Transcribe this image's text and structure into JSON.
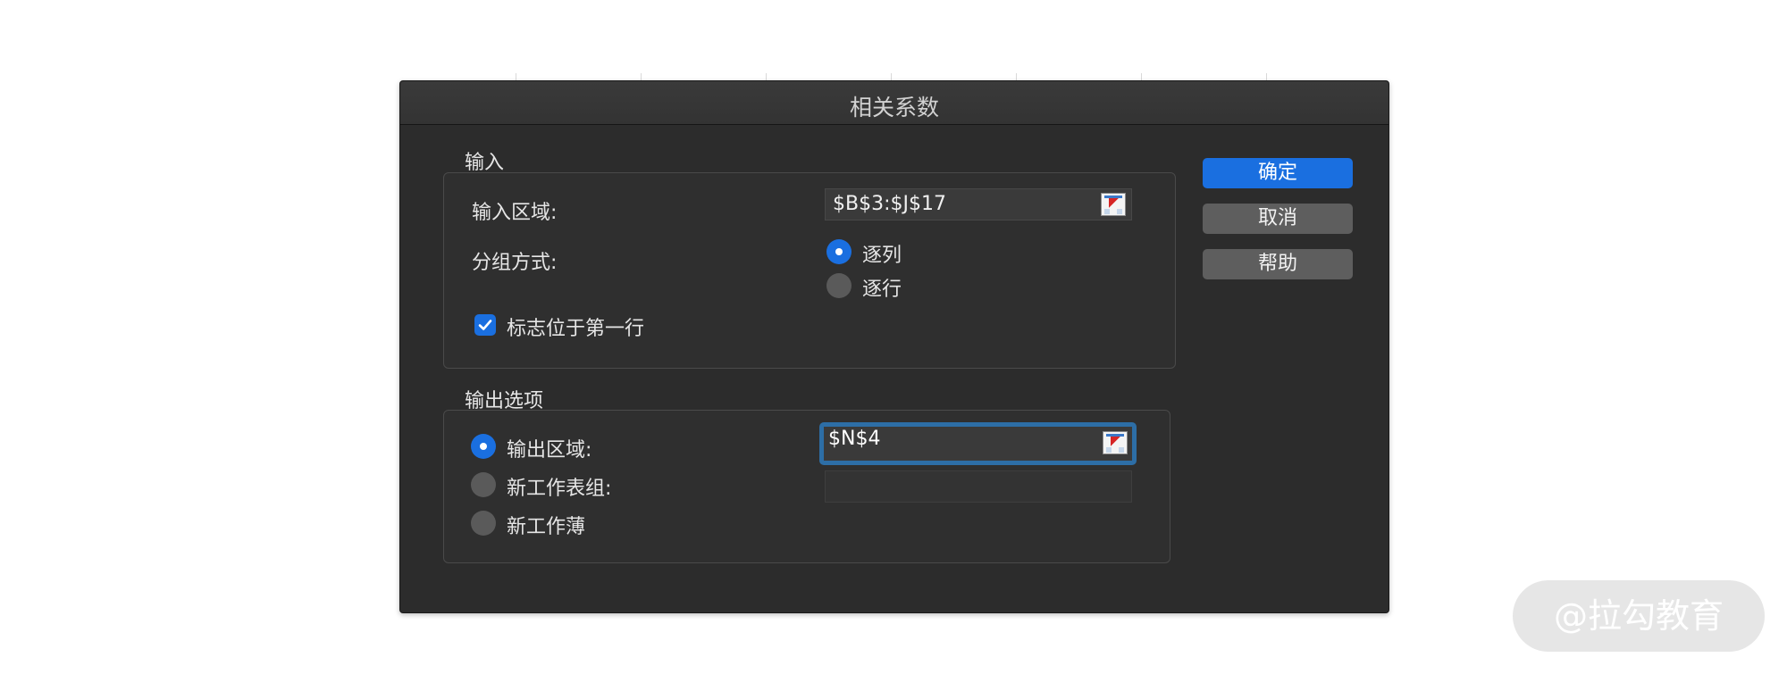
{
  "dialog": {
    "title": "相关系数",
    "buttons": {
      "ok": "确定",
      "cancel": "取消",
      "help": "帮助"
    }
  },
  "input_section": {
    "label": "输入",
    "range_label": "输入区域:",
    "range_value": "$B$3:$J$17",
    "grouping_label": "分组方式:",
    "grouping_options": [
      "逐列",
      "逐行"
    ],
    "grouping_selected": "逐列",
    "labels_first_row": {
      "label": "标志位于第一行",
      "checked": true
    }
  },
  "output_section": {
    "label": "输出选项",
    "options": [
      "输出区域:",
      "新工作表组:",
      "新工作薄"
    ],
    "selected": "输出区域:",
    "output_range_value": "$N$4",
    "new_sheet_value": ""
  },
  "watermark": "@拉勾教育",
  "colors": {
    "accent": "#1a6fe0",
    "focus_ring": "#2d6ea6",
    "dialog_bg": "#2c2c2c"
  }
}
